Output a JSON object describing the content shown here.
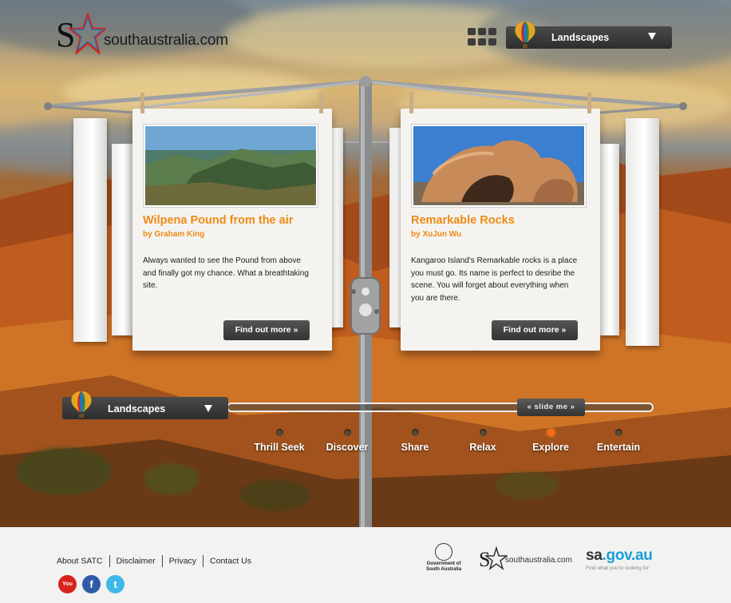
{
  "header": {
    "brand_wordmark": "southaustralia.com",
    "grid_icon": "grid-icon",
    "category_select": {
      "value": "Landscapes",
      "icon": "balloon-icon"
    }
  },
  "cards": [
    {
      "title": "Wilpena Pound from the air",
      "byline": "by Graham King",
      "description": "Always wanted to see the Pound from above and finally got my chance. What a breathtaking site.",
      "button_label": "Find out more »"
    },
    {
      "title": "Remarkable Rocks",
      "byline": "by XuJun Wu",
      "description": "Kangaroo Island's Remarkable rocks is a place you must go. Its name is perfect to desribe the scene. You will forget about everything when you are there.",
      "button_label": "Find out more »"
    }
  ],
  "slider": {
    "select_value": "Landscapes",
    "handle_label": "« slide me »",
    "categories": [
      {
        "label": "Thrill Seek",
        "active": false
      },
      {
        "label": "Discover",
        "active": false
      },
      {
        "label": "Share",
        "active": false
      },
      {
        "label": "Relax",
        "active": false
      },
      {
        "label": "Explore",
        "active": true
      },
      {
        "label": "Entertain",
        "active": false
      }
    ]
  },
  "footer": {
    "links": [
      "About SATC",
      "Disclaimer",
      "Privacy",
      "Contact Us"
    ],
    "social": [
      {
        "name": "youtube",
        "glyph": "You",
        "color": "#d8231c"
      },
      {
        "name": "facebook",
        "glyph": "f",
        "color": "#2f5aa7"
      },
      {
        "name": "twitter",
        "glyph": "t",
        "color": "#3fb7e8"
      }
    ],
    "gov_logo_text": "Government of South Australia",
    "sa_logo_wordmark": "southaustralia.com",
    "sagov": {
      "prefix": "sa",
      "suffix": ".gov.au",
      "tagline": "Find what you're looking for"
    }
  },
  "colors": {
    "accent_orange": "#f08a14",
    "active_dot": "#ff6a10",
    "dark_button": "#3a3a3a"
  }
}
